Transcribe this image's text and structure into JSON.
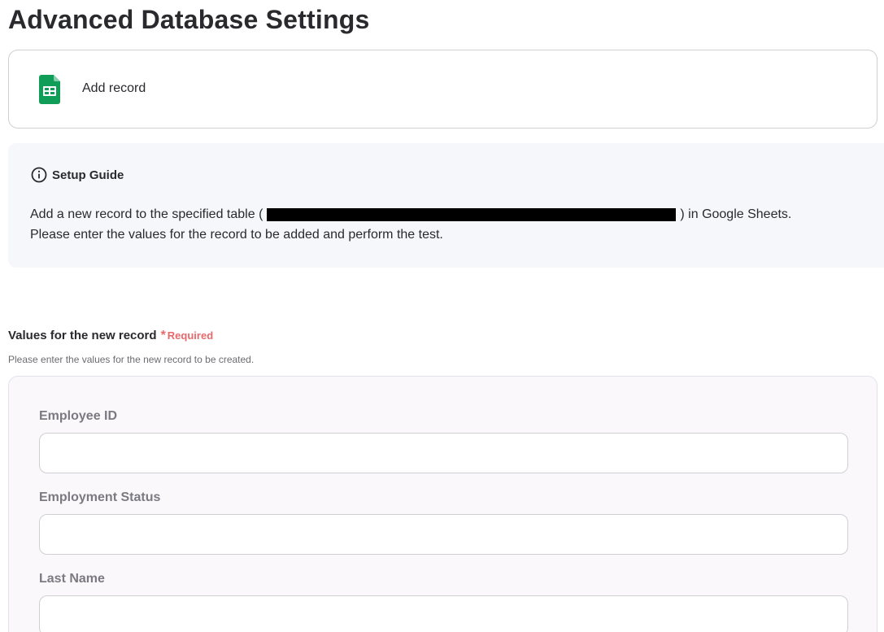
{
  "page": {
    "title": "Advanced Database Settings"
  },
  "action": {
    "icon": "google-sheets-icon",
    "label": "Add record"
  },
  "guide": {
    "icon": "info-icon",
    "title": "Setup Guide",
    "line1_prefix": "Add a new record to the specified table (",
    "line1_suffix": ") in Google Sheets.",
    "line2": "Please enter the values for the record to be added and perform the test."
  },
  "section": {
    "title": "Values for the new record",
    "required_mark": "*",
    "required_label": "Required",
    "help": "Please enter the values for the new record to be created."
  },
  "fields": [
    {
      "label": "Employee ID",
      "value": ""
    },
    {
      "label": "Employment Status",
      "value": ""
    },
    {
      "label": "Last Name",
      "value": ""
    }
  ],
  "colors": {
    "required": "#e8696c",
    "sheets_green": "#0f9d58",
    "guide_bg": "#f5f7fa"
  }
}
